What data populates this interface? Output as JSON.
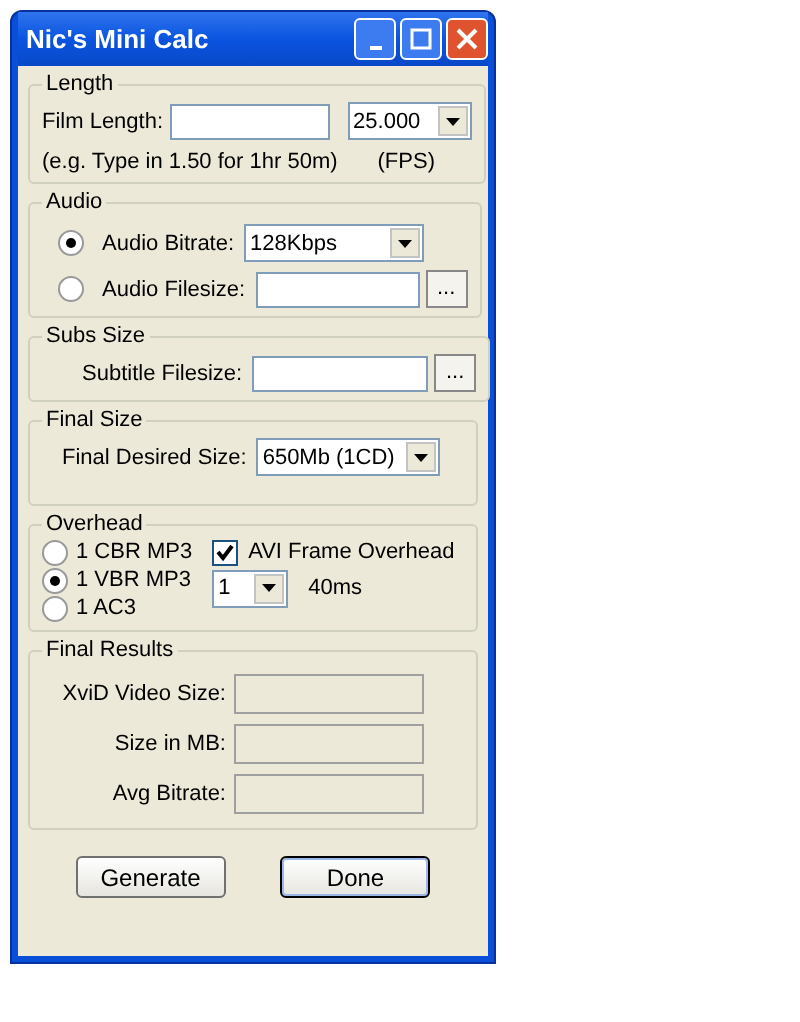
{
  "window": {
    "title": "Nic's Mini Calc"
  },
  "length": {
    "legend": "Length",
    "label": "Film Length:",
    "fps": "25.000",
    "hint": "(e.g. Type in 1.50 for 1hr 50m)",
    "fps_label": "(FPS)"
  },
  "audio": {
    "legend": "Audio",
    "options": [
      {
        "label": "Audio Bitrate:",
        "selected": true,
        "kind": "dropdown",
        "value": "128Kbps"
      },
      {
        "label": "Audio Filesize:",
        "selected": false,
        "kind": "file",
        "browse": "..."
      }
    ]
  },
  "subs": {
    "legend": "Subs Size",
    "label": "Subtitle Filesize:",
    "browse": "..."
  },
  "final_size": {
    "legend": "Final Size",
    "label": "Final Desired Size:",
    "value": "650Mb (1CD)"
  },
  "overhead": {
    "legend": "Overhead",
    "options": [
      {
        "label": "1 CBR MP3",
        "selected": false
      },
      {
        "label": "1 VBR MP3",
        "selected": true
      },
      {
        "label": "1 AC3",
        "selected": false
      }
    ],
    "avi": {
      "label": "AVI Frame Overhead",
      "checked": true
    },
    "frames": "1",
    "frame_time": "40ms"
  },
  "results": {
    "legend": "Final Results",
    "fields": [
      {
        "label": "XviD Video Size:",
        "disabled": true
      },
      {
        "label": "Size in MB:",
        "disabled": true
      },
      {
        "label": "Avg Bitrate:",
        "disabled": true
      }
    ]
  },
  "buttons": [
    {
      "label": "Generate",
      "focused": false
    },
    {
      "label": "Done",
      "focused": true
    }
  ]
}
